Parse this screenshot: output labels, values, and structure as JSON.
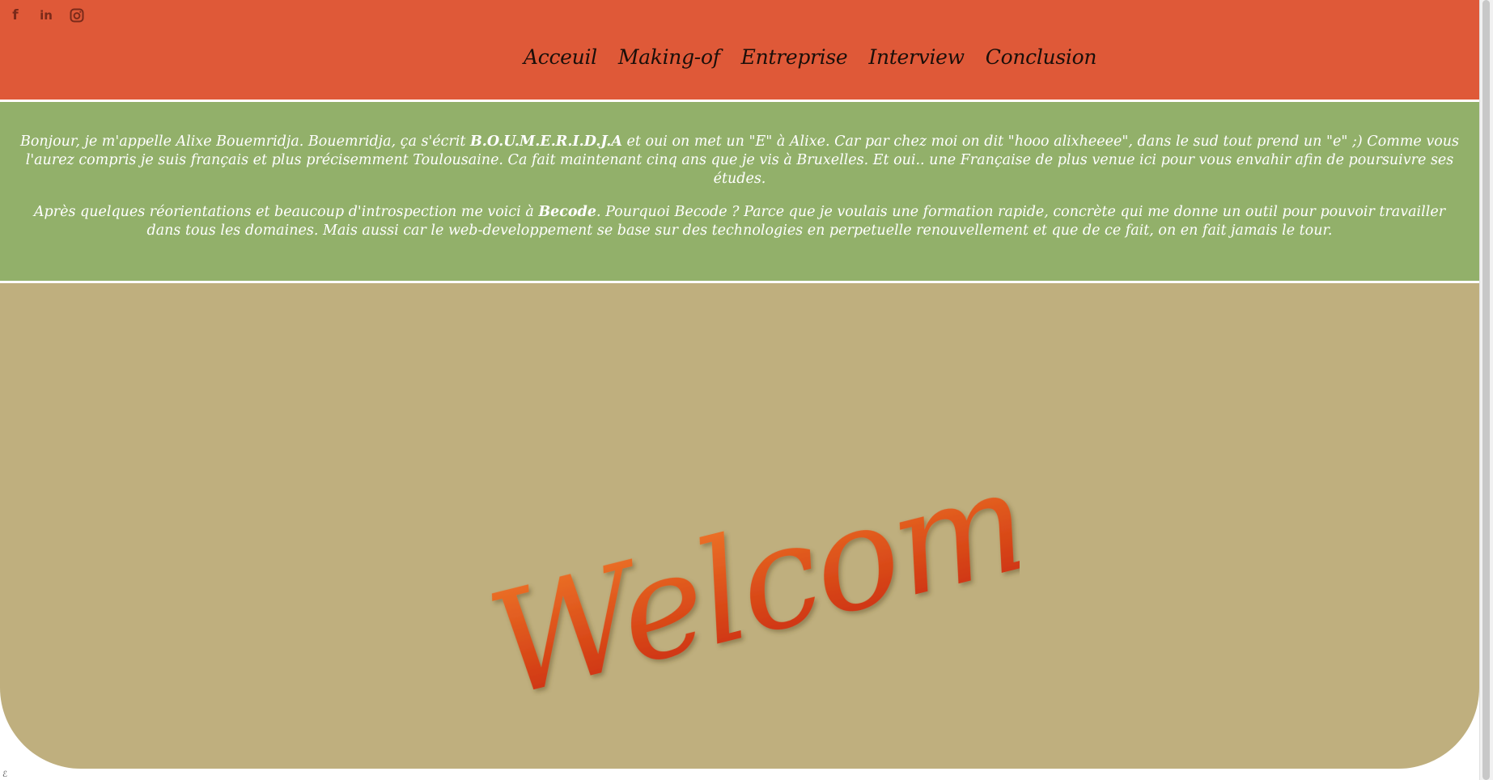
{
  "social": [
    {
      "name": "facebook-icon",
      "glyph": "f"
    },
    {
      "name": "linkedin-icon",
      "glyph": "in"
    },
    {
      "name": "instagram-icon",
      "glyph": "◙"
    }
  ],
  "nav": {
    "items": [
      "Acceuil",
      "Making-of",
      "Entreprise",
      "Interview",
      "Conclusion"
    ]
  },
  "intro": {
    "p1_a": "Bonjour, je m'appelle Alixe Bouemridja. Bouemridja, ça s'écrit ",
    "p1_bold": "B.O.U.M.E.R.I.D.J.A",
    "p1_b": " et oui on met un \"E\" à Alixe. Car par chez moi on dit \"hooo alixheeee\", dans le sud tout prend un \"e\" ;) Comme vous l'aurez compris je suis français et plus précisemment Toulousaine. Ca fait maintenant cinq ans que je vis à Bruxelles. Et oui.. une Française de plus venue ici pour vous envahir afin de poursuivre ses études.",
    "p2_a": "Après quelques réorientations et beaucoup d'introspection me voici à ",
    "p2_bold": "Becode",
    "p2_b": ". Pourquoi Becode ? Parce que je voulais une formation rapide, concrète qui me donne un outil pour pouvoir travailler dans tous les domaines. Mais aussi car le web-developpement se base sur des technologies en perpetuelle renouvellement et que de ce fait, on en fait jamais le tour."
  },
  "welcome": {
    "text": "Welcome!"
  },
  "colors": {
    "header": "#df5938",
    "intro": "#92b06a",
    "welcome_band": "#bfaf7e",
    "welcome_text_top": "#f07a2a",
    "welcome_text_bottom": "#c8260c"
  }
}
